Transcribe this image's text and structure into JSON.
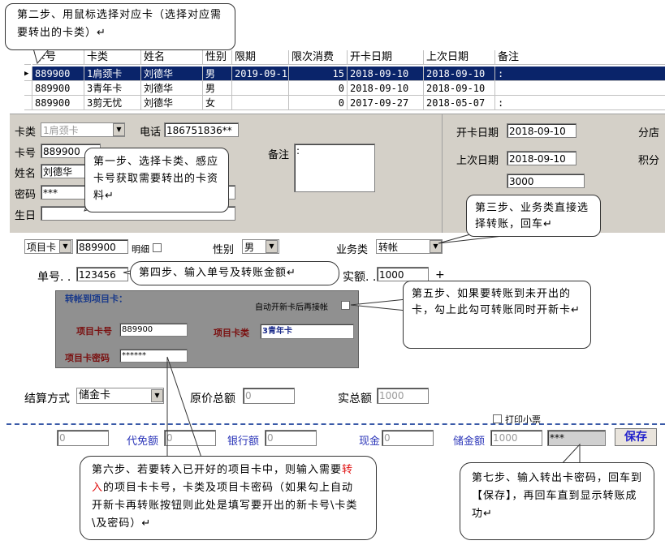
{
  "callouts": {
    "step2": "第二步、用鼠标选择对应卡（选择对应需要转出的卡类）↵",
    "step1": "第一步、选择卡类、感应卡号获取需要转出的卡资料↵",
    "step3": "第三步、业务类直接选择转账，回车↵",
    "step4": "第四步、输入单号及转账金额↵",
    "step5": "第五步、如果要转账到未开出的卡，勾上此勾可转账同时开新卡↵",
    "step6_a": "第六步、若要转入已开好的项目卡中，则输入需要",
    "step6_red": "转入",
    "step6_b": "的项目卡卡号，卡类及项目卡密码（如果勾上自动开新卡再转账按钮则此处是填写要开出的新卡号\\卡类\\及密码）↵",
    "step7": "第七步、输入转出卡密码，回车到【保存】，再回车直到显示转账成功↵"
  },
  "grid": {
    "headers": [
      "卡号",
      "卡类",
      "姓名",
      "性别",
      "限期",
      "限次消费",
      "开卡日期",
      "上次日期",
      "备注"
    ],
    "rows": [
      {
        "marker": "▶",
        "card": "889900",
        "type": "1肩颈卡",
        "name": "刘德华",
        "sex": "男",
        "limit": "2019-09-1",
        "count": "15",
        "open": "2018-09-10",
        "last": "2018-09-10",
        "note": ":"
      },
      {
        "marker": "",
        "card": "889900",
        "type": "3青年卡",
        "name": "刘德华",
        "sex": "男",
        "limit": "",
        "count": "0",
        "open": "2018-09-10",
        "last": "2018-09-10",
        "note": ""
      },
      {
        "marker": "",
        "card": "889900",
        "type": "3剪无忧",
        "name": "刘德华",
        "sex": "女",
        "limit": "",
        "count": "0",
        "open": "2017-09-27",
        "last": "2018-05-07",
        "note": ":"
      }
    ]
  },
  "card_info": {
    "card_type_label": "卡类",
    "card_type_value": "1肩颈卡",
    "phone_label": "电话",
    "phone_value": "186751836**",
    "card_no_label": "卡号",
    "card_no_value": "889900",
    "name_label": "姓名",
    "name_value": "刘德华",
    "password_label": "密码",
    "password_value": "***",
    "birthday_label": "生日",
    "note_label": "备注",
    "note_value": ":",
    "open_date_label": "开卡日期",
    "open_date_value": "2018-09-10",
    "last_date_label": "上次日期",
    "last_date_value": "2018-09-10",
    "balance_value": "3000",
    "branch_label": "分店",
    "points_label": "积分"
  },
  "business": {
    "item_card_select": "项目卡",
    "item_card_no": "889900",
    "detail_label": "明细",
    "sex_label": "性别",
    "sex_value": "男",
    "biz_type_label": "业务类",
    "biz_type_value": "转帐",
    "order_label": "单号. .",
    "order_value": "123456",
    "actual_label": "实额. .",
    "actual_value": "1000",
    "plus": "+"
  },
  "transfer": {
    "title": "转帐到项目卡：",
    "auto_open_label": "自动开新卡后再接帐",
    "item_card_no_label": "项目卡号",
    "item_card_no_value": "889900",
    "item_card_type_label": "项目卡类",
    "item_card_type_value": "3青年卡",
    "item_card_pwd_label": "项目卡密码",
    "item_card_pwd_value": "******"
  },
  "settlement": {
    "method_label": "结算方式",
    "method_value": "储金卡",
    "orig_total_label": "原价总额",
    "orig_total_value": "0",
    "actual_total_label": "实总额",
    "actual_total_value": "1000",
    "print_label": "打印小票",
    "field0_value": "0",
    "waiver_label": "代免额",
    "waiver_value": "0",
    "bank_label": "银行额",
    "bank_value": "0",
    "cash_label": "现金",
    "cash_value": "0",
    "stored_label": "储金额",
    "stored_value": "1000",
    "pwd_value": "***",
    "save_label": "保存"
  }
}
